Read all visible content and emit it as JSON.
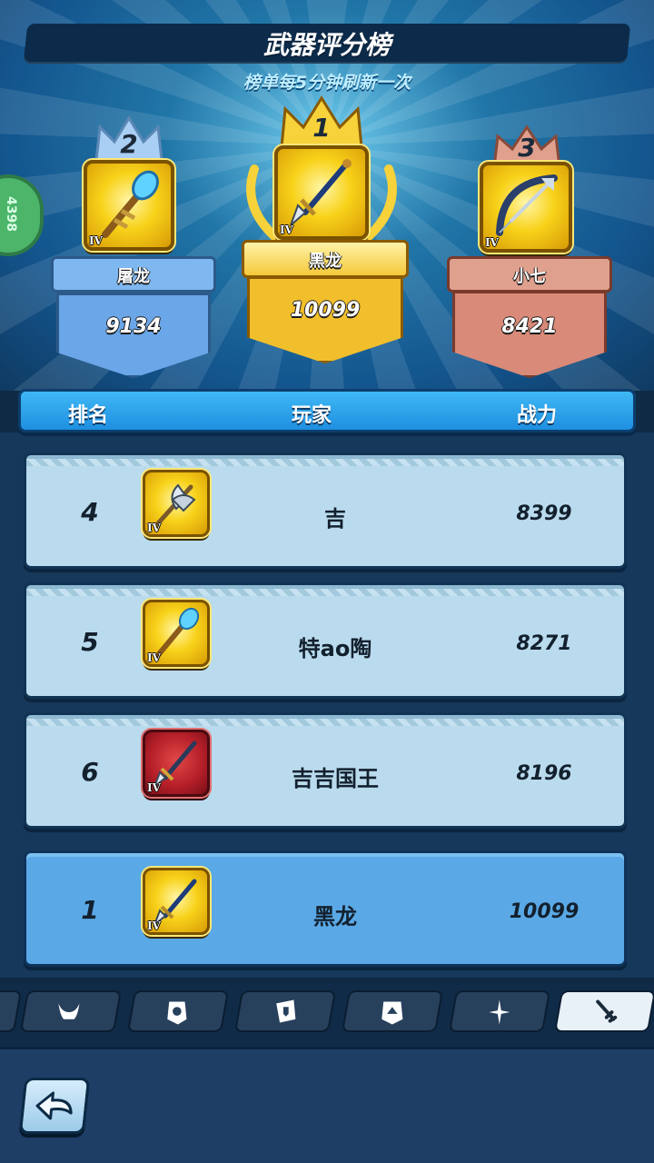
{
  "header": {
    "title": "武器评分榜",
    "subtitle": "榜单每5分钟刷新一次"
  },
  "side_badge": "4398",
  "podium": [
    {
      "rank": "2",
      "name": "屠龙",
      "score": "9134",
      "tier": "IV",
      "weapon": "staff-icon",
      "color": "#7fb7f0"
    },
    {
      "rank": "1",
      "name": "黑龙",
      "score": "10099",
      "tier": "IV",
      "weapon": "spear-icon",
      "color": "#f5c83a"
    },
    {
      "rank": "3",
      "name": "小七",
      "score": "8421",
      "tier": "IV",
      "weapon": "bow-icon",
      "color": "#d98a78"
    }
  ],
  "table": {
    "col_rank": "排名",
    "col_player": "玩家",
    "col_power": "战力",
    "rows": [
      {
        "rank": "4",
        "player": "吉",
        "power": "8399",
        "tier": "IV",
        "weapon": "axe-icon"
      },
      {
        "rank": "5",
        "player": "特ao陶",
        "power": "8271",
        "tier": "IV",
        "weapon": "staff-icon"
      },
      {
        "rank": "6",
        "player": "吉吉国王",
        "power": "8196",
        "tier": "IV",
        "weapon": "spear-icon"
      }
    ],
    "mine": {
      "rank": "1",
      "player": "黑龙",
      "power": "10099",
      "tier": "IV",
      "weapon": "spear-icon"
    }
  },
  "tabs": [
    {
      "icon": "horned-helmet-icon"
    },
    {
      "icon": "gear-badge-icon"
    },
    {
      "icon": "shield-card-icon"
    },
    {
      "icon": "spade-badge-icon"
    },
    {
      "icon": "shuriken-icon"
    },
    {
      "icon": "sword-icon",
      "active": true
    }
  ],
  "colors": {
    "rank1": "#f5c83a",
    "rank2": "#7fb7f0",
    "rank3": "#d98a78",
    "header": "#2aa0ea"
  }
}
